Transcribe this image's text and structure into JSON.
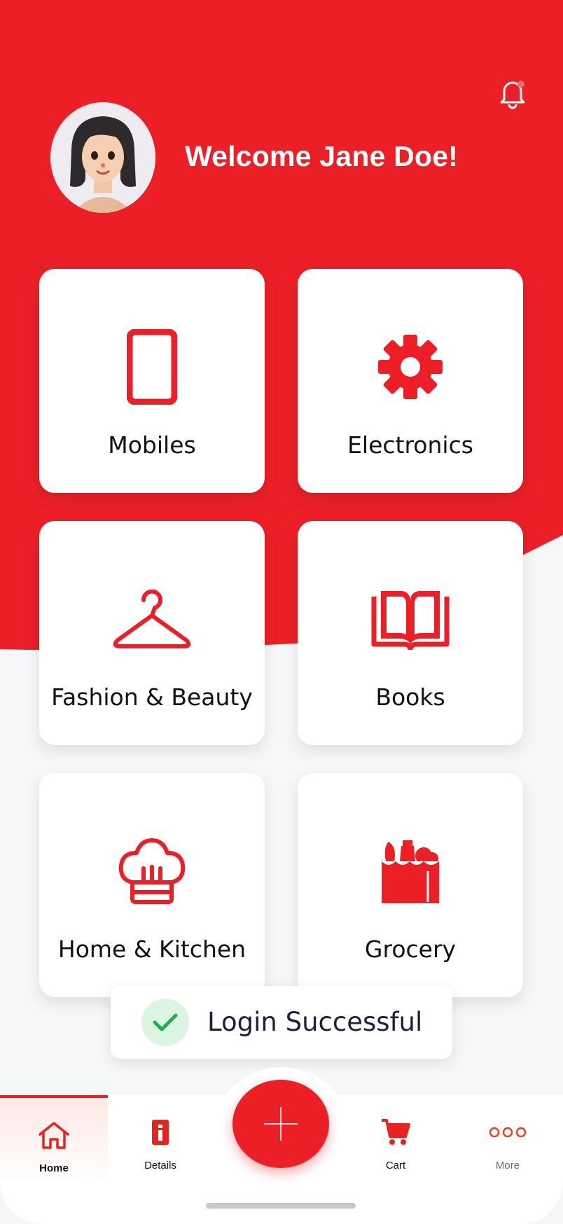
{
  "header": {
    "welcome": "Welcome Jane Doe!",
    "notification_dot": true
  },
  "categories": [
    {
      "label": "Mobiles",
      "icon": "mobile-icon"
    },
    {
      "label": "Electronics",
      "icon": "gear-icon"
    },
    {
      "label": "Fashion & Beauty",
      "icon": "hanger-icon"
    },
    {
      "label": "Books",
      "icon": "book-icon"
    },
    {
      "label": "Home & Kitchen",
      "icon": "chef-hat-icon"
    },
    {
      "label": "Grocery",
      "icon": "grocery-bag-icon"
    }
  ],
  "toast": {
    "message": "Login Successful",
    "icon": "check-icon"
  },
  "nav": {
    "home": "Home",
    "details": "Details",
    "add": "+",
    "cart": "Cart",
    "more": "More",
    "active": "Home"
  },
  "colors": {
    "brand_red": "#ec1f27",
    "background": "#f6f7f9",
    "toast_check": "#22b04b"
  }
}
